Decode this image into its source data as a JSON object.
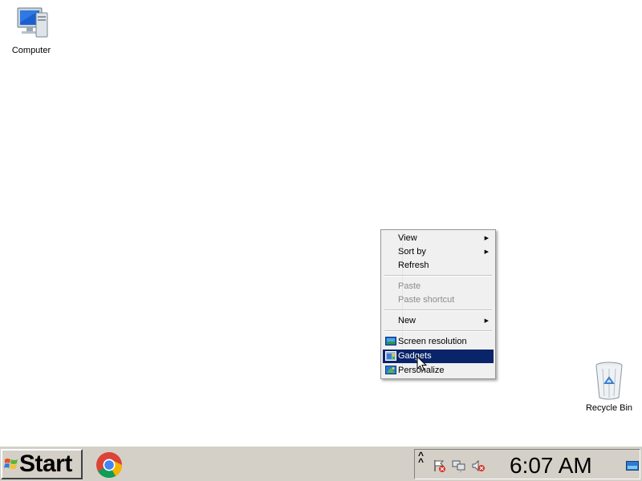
{
  "desktop": {
    "icons": [
      {
        "label": "Computer",
        "icon": "computer-icon"
      },
      {
        "label": "Recycle Bin",
        "icon": "recycle-bin-icon"
      }
    ]
  },
  "context_menu": {
    "items": [
      {
        "label": "View",
        "has_submenu": true,
        "enabled": true
      },
      {
        "label": "Sort by",
        "has_submenu": true,
        "enabled": true
      },
      {
        "label": "Refresh",
        "enabled": true
      },
      {
        "label": "Paste",
        "enabled": false
      },
      {
        "label": "Paste shortcut",
        "enabled": false
      },
      {
        "label": "New",
        "has_submenu": true,
        "enabled": true
      },
      {
        "label": "Screen resolution",
        "icon": "screen-resolution-icon",
        "enabled": true
      },
      {
        "label": "Gadgets",
        "icon": "gadgets-icon",
        "enabled": true,
        "highlighted": true
      },
      {
        "label": "Personalize",
        "icon": "personalize-icon",
        "enabled": true
      }
    ],
    "highlight_color": "#0a246a"
  },
  "taskbar": {
    "start_label": "Start",
    "pinned": [
      {
        "icon": "chrome-icon"
      }
    ],
    "clock": "6:07 AM",
    "tray_icons": [
      "flag-icon",
      "network-icon",
      "volume-icon"
    ]
  }
}
